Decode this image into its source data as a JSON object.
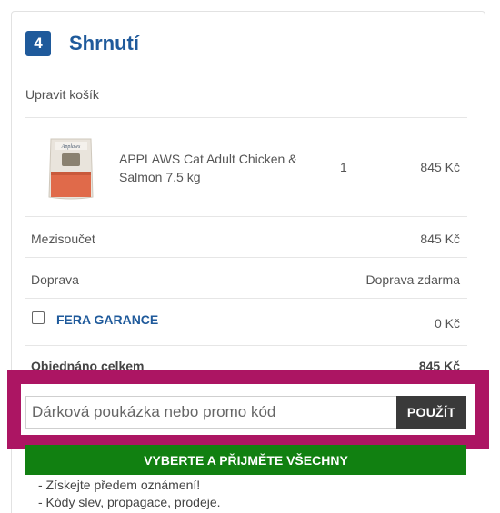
{
  "summary": {
    "step_number": "4",
    "title": "Shrnutí",
    "edit_cart": "Upravit košík"
  },
  "product": {
    "name": "APPLAWS Cat Adult Chicken & Salmon 7.5 kg",
    "quantity": "1",
    "price": "845 Kč",
    "image_brand": "Applaws"
  },
  "totals": {
    "subtotal_label": "Mezisoučet",
    "subtotal_value": "845 Kč",
    "shipping_label": "Doprava",
    "shipping_value": "Doprava zdarma",
    "garance_label": "FERA GARANCE",
    "garance_value": "0 Kč",
    "total_label": "Objednáno celkem",
    "total_value": "845 Kč"
  },
  "promo": {
    "placeholder": "Dárková poukázka nebo promo kód",
    "value": "",
    "apply_label": "POUŽÍT"
  },
  "consent": {
    "button_label": "VYBERTE A PŘIJMĚTE VŠECHNY",
    "benefits": [
      "- Získejte předem oznámení!",
      "- Kódy slev, propagace, prodeje."
    ]
  },
  "colors": {
    "brand_blue": "#1f5a9b",
    "highlight_magenta": "#ac1563",
    "consent_green": "#118011",
    "apply_dark": "#3a3a3a"
  }
}
